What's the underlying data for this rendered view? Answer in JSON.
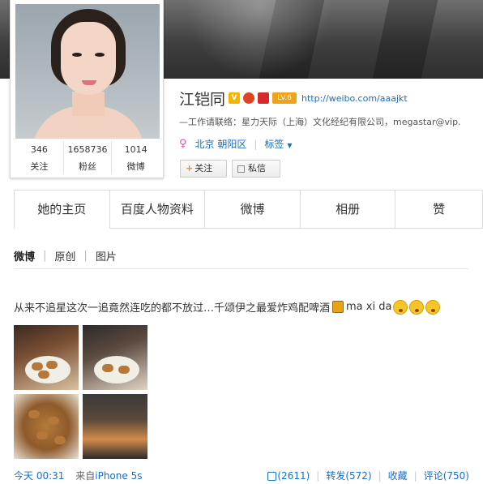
{
  "profile": {
    "stats": [
      {
        "num": "346",
        "label": "关注"
      },
      {
        "num": "1658736",
        "label": "粉丝"
      },
      {
        "num": "1014",
        "label": "微博"
      }
    ],
    "name": "江铠同",
    "badges": {
      "v": "V",
      "level": "LV.6"
    },
    "blog_link": "http://weibo.com/aaajkt",
    "work": "—工作请联络：星力天际（上海）文化经纪有限公司，megastar@vip.",
    "location": "北京 朝阳区",
    "tags_label": "标签",
    "follow_label": "关注",
    "message_label": "私信"
  },
  "tabs": [
    {
      "label": "她的主页"
    },
    {
      "label": "百度人物资料"
    },
    {
      "label": "微博"
    },
    {
      "label": "相册"
    },
    {
      "label": "赞"
    }
  ],
  "subnav": {
    "items": [
      "微博",
      "原创",
      "图片"
    ]
  },
  "post": {
    "text": "从来不追星这次一追竟然连吃的都不放过…千颂伊之最爱炸鸡配啤酒",
    "text_tail": "ma xi da",
    "time": "今天 00:31",
    "from_label": "来自",
    "device": "iPhone 5s",
    "likes": "(2611)",
    "repost": "转发(572)",
    "favorite": "收藏",
    "comment": "评论(750)"
  },
  "colors": {
    "link": "#1a6ec6",
    "accent": "#f28c1a"
  }
}
